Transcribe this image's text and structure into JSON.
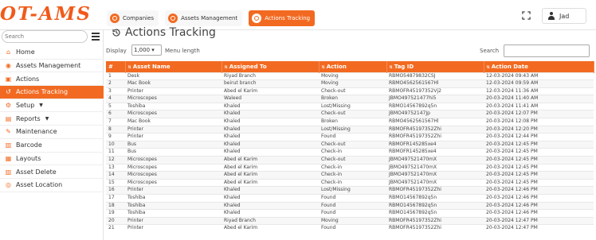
{
  "brand": "OT-AMS",
  "tabs": [
    {
      "label": "Companies",
      "icon": "companies-icon"
    },
    {
      "label": "Assets Management",
      "icon": "assets-icon"
    },
    {
      "label": "Actions Tracking",
      "icon": "tracking-icon"
    }
  ],
  "user": {
    "name": "Jad"
  },
  "sidebar": {
    "search_placeholder": "Search",
    "items": [
      {
        "label": "Home",
        "icon": "home-icon"
      },
      {
        "label": "Assets Management",
        "icon": "assets-icon"
      },
      {
        "label": "Actions",
        "icon": "actions-icon"
      },
      {
        "label": "Actions Tracking",
        "icon": "history-icon"
      },
      {
        "label": "Setup",
        "icon": "gear-icon"
      },
      {
        "label": "Reports",
        "icon": "reports-icon"
      },
      {
        "label": "Maintenance",
        "icon": "wrench-icon"
      },
      {
        "label": "Barcode",
        "icon": "barcode-icon"
      },
      {
        "label": "Layouts",
        "icon": "layouts-icon"
      },
      {
        "label": "Asset Delete",
        "icon": "trash-icon"
      },
      {
        "label": "Asset Location",
        "icon": "location-icon"
      }
    ]
  },
  "main": {
    "title": "Actions Tracking",
    "display_label": "Display",
    "display_value": "1,000",
    "display_suffix": "Menu length",
    "search_label": "Search",
    "columns": [
      "#",
      "Asset Name",
      "Assigned To",
      "Action",
      "Tag ID",
      "Action Date"
    ],
    "rows": [
      [
        "1",
        "Desk",
        "Riyad Branch",
        "Moving",
        "RBMO54879832CSJ",
        "12-03-2024 09:43 AM"
      ],
      [
        "2",
        "Mac Book",
        "beirut branch",
        "Moving",
        "RBMO4562561567Hl",
        "12-03-2024 09:59 AM"
      ],
      [
        "3",
        "Printer",
        "Abed el Karim",
        "Check-out",
        "RBMOFR45197352Vj2",
        "12-03-2024 11:36 AM"
      ],
      [
        "4",
        "Microscopes",
        "Waleed",
        "Broken",
        "JBMO497521477hi5",
        "20-03-2024 11:40 AM"
      ],
      [
        "5",
        "Toshiba",
        "Khaled",
        "Lost/Missing",
        "RBMO14567892q5n",
        "20-03-2024 11:41 AM"
      ],
      [
        "6",
        "Microscopes",
        "Khaled",
        "Check-out",
        "JBMO49752147Jp",
        "20-03-2024 12:07 PM"
      ],
      [
        "7",
        "Mac Book",
        "Khaled",
        "Broken",
        "RBMO4562561567Hl",
        "20-03-2024 12:08 PM"
      ],
      [
        "8",
        "Printer",
        "Khaled",
        "Lost/Missing",
        "RBMOFR45197352Zhi",
        "20-03-2024 12:20 PM"
      ],
      [
        "9",
        "Printer",
        "Khaled",
        "Found",
        "RBMOFR45197352Zhi",
        "20-03-2024 12:44 PM"
      ],
      [
        "10",
        "Bus",
        "Khaled",
        "Check-out",
        "RBMOFR145285xe4",
        "20-03-2024 12:45 PM"
      ],
      [
        "11",
        "Bus",
        "Khaled",
        "Check-in",
        "RBMOFR145285xe4",
        "20-03-2024 12:45 PM"
      ],
      [
        "12",
        "Microscopes",
        "Abed el Karim",
        "Check-out",
        "JBMO497521470mX",
        "20-03-2024 12:45 PM"
      ],
      [
        "13",
        "Microscopes",
        "Abed el Karim",
        "Check-in",
        "JBMO497521470mX",
        "20-03-2024 12:45 PM"
      ],
      [
        "14",
        "Microscopes",
        "Abed el Karim",
        "Check-in",
        "JBMO497521470mX",
        "20-03-2024 12:45 PM"
      ],
      [
        "15",
        "Microscopes",
        "Abed el Karim",
        "Check-in",
        "JBMO497521470mX",
        "20-03-2024 12:45 PM"
      ],
      [
        "16",
        "Printer",
        "Khaled",
        "Lost/Missing",
        "RBMOFR45197352Zhi",
        "20-03-2024 12:46 PM"
      ],
      [
        "17",
        "Toshiba",
        "Khaled",
        "Found",
        "RBMO14567892q5n",
        "20-03-2024 12:46 PM"
      ],
      [
        "18",
        "Toshiba",
        "Khaled",
        "Found",
        "RBMO14567892q5n",
        "20-03-2024 12:46 PM"
      ],
      [
        "19",
        "Toshiba",
        "Khaled",
        "Found",
        "RBMO14567892q5n",
        "20-03-2024 12:46 PM"
      ],
      [
        "20",
        "Printer",
        "Riyad Branch",
        "Moving",
        "RBMOFR45197352Zhi",
        "20-03-2024 12:47 PM"
      ],
      [
        "21",
        "Printer",
        "Abed el Karim",
        "Found",
        "RBMOFR45197352Zhi",
        "20-03-2024 12:47 PM"
      ]
    ]
  },
  "colors": {
    "accent": "#f26a21"
  }
}
